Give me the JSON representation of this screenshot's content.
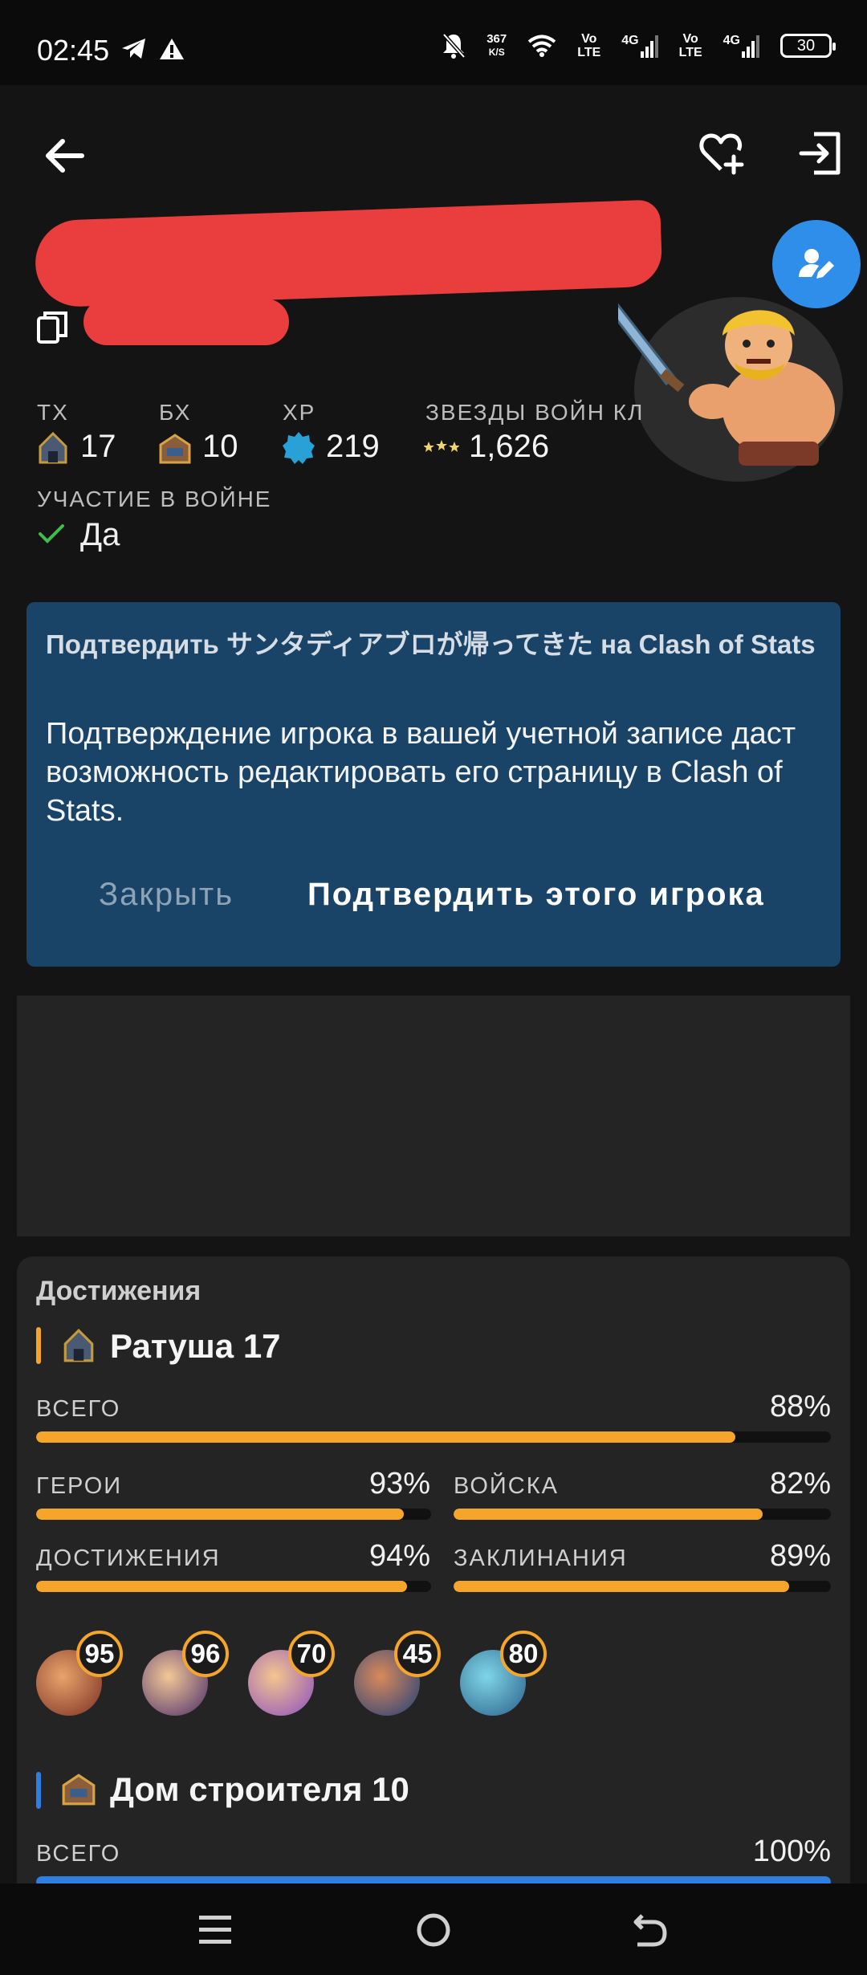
{
  "status_bar": {
    "time": "02:45",
    "net_speed_value": "367",
    "net_speed_unit": "K/S",
    "sim1_type": "Vo",
    "sim1_sub": "LTE",
    "sim1_gen": "4G",
    "sim2_type": "Vo",
    "sim2_sub": "LTE",
    "sim2_gen": "4G",
    "battery": "30",
    "icons": [
      "telegram-icon",
      "warning-icon",
      "mute-bell-icon",
      "wifi-icon",
      "signal-icon"
    ]
  },
  "app_bar": {
    "icons": [
      "back-arrow-icon",
      "favorite-add-icon",
      "exit-icon"
    ]
  },
  "profile": {
    "stats": [
      {
        "label": "ТХ",
        "value": "17",
        "icon": "town-hall-icon"
      },
      {
        "label": "БХ",
        "value": "10",
        "icon": "builder-hall-icon"
      },
      {
        "label": "XP",
        "value": "219",
        "icon": "xp-badge-icon"
      },
      {
        "label": "ЗВЕЗДЫ ВОЙН КЛ",
        "value": "1,626",
        "icon": "war-stars-icon"
      }
    ],
    "war_label": "УЧАСТИЕ В ВОЙНЕ",
    "war_value": "Да"
  },
  "verify_card": {
    "title": "Подтвердить サンタディアブロが帰ってきた на Clash of Stats",
    "body": "Подтверждение игрока в вашей учетной записе даст возможность редактировать его страницу в Clash of Stats.",
    "close_label": "Закрыть",
    "confirm_label": "Подтвердить этого игрока"
  },
  "achievements": {
    "title": "Достижения",
    "town_hall": {
      "title": "Ратуша 17",
      "accent": "#f4a52a",
      "total_label": "ВСЕГО",
      "total_value": "88%",
      "total_fraction": 0.88,
      "heroes_label": "ГЕРОИ",
      "heroes_value": "93%",
      "heroes_fraction": 0.93,
      "troops_label": "ВОЙСКА",
      "troops_value": "82%",
      "troops_fraction": 0.82,
      "achievements_label": "ДОСТИЖЕНИЯ",
      "achievements_value": "94%",
      "achievements_fraction": 0.94,
      "spells_label": "ЗАКЛИНАНИЯ",
      "spells_value": "89%",
      "spells_fraction": 0.89,
      "heroes": [
        {
          "name": "barbarian-king",
          "level": "95"
        },
        {
          "name": "archer-queen",
          "level": "96"
        },
        {
          "name": "grand-warden",
          "level": "70"
        },
        {
          "name": "royal-champion",
          "level": "45"
        },
        {
          "name": "minion-prince",
          "level": "80"
        }
      ]
    },
    "builder_hall": {
      "title": "Дом строителя 10",
      "accent": "#2f7fe0",
      "total_label": "ВСЕГО",
      "total_value": "100%",
      "total_fraction": 1.0
    }
  },
  "nav_bar": {
    "icons": [
      "menu-icon",
      "home-icon",
      "back-icon"
    ]
  }
}
